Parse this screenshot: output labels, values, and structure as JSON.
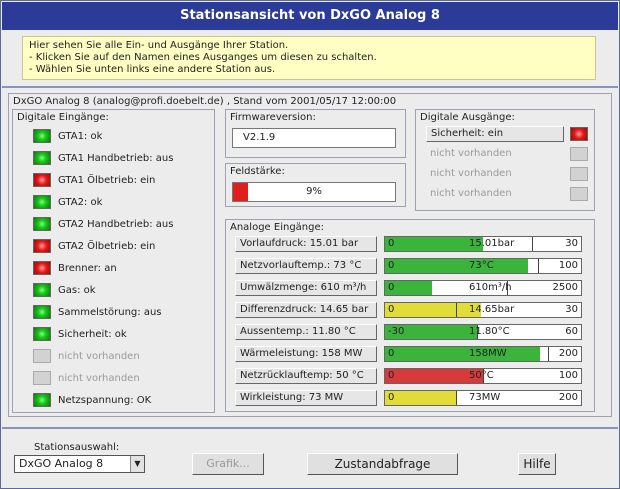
{
  "window": {
    "title": "Stationsansicht von DxGO Analog 8"
  },
  "info": {
    "lines": [
      "Hier sehen Sie alle Ein- und Ausgänge Ihrer Station.",
      "- Klicken Sie auf den Namen eines Ausganges um diesen zu schalten.",
      "- Wählen Sie unten links eine andere Station aus."
    ]
  },
  "station_line": "DxGO Analog 8 (analog@profi.doebelt.de) , Stand vom 2001/05/17 12:00:00",
  "digital_inputs": {
    "title": "Digitale Eingänge:",
    "items": [
      {
        "label": "GTA1: ok",
        "state": "green"
      },
      {
        "label": "GTA1 Handbetrieb: aus",
        "state": "green"
      },
      {
        "label": "GTA1 Ölbetrieb: ein",
        "state": "red"
      },
      {
        "label": "GTA2: ok",
        "state": "green"
      },
      {
        "label": "GTA2 Handbetrieb: aus",
        "state": "green"
      },
      {
        "label": "GTA2 Ölbetrieb: ein",
        "state": "red"
      },
      {
        "label": "Brenner: an",
        "state": "red"
      },
      {
        "label": "Gas: ok",
        "state": "green"
      },
      {
        "label": "Sammelstörung: aus",
        "state": "green"
      },
      {
        "label": "Sicherheit: ok",
        "state": "green"
      },
      {
        "label": "nicht vorhanden",
        "state": "gray"
      },
      {
        "label": "nicht vorhanden",
        "state": "gray"
      },
      {
        "label": "Netzspannung: OK",
        "state": "green"
      }
    ]
  },
  "firmware": {
    "title": "Firmwareversion:",
    "value": "V2.1.9"
  },
  "signal": {
    "title": "Feldstärke:",
    "value_text": "9%",
    "fraction": 0.09
  },
  "digital_outputs": {
    "title": "Digitale Ausgänge:",
    "items": [
      {
        "label": "Sicherheit: ein",
        "state": "red",
        "enabled": true
      },
      {
        "label": "nicht vorhanden",
        "state": "gray",
        "enabled": false
      },
      {
        "label": "nicht vorhanden",
        "state": "gray",
        "enabled": false
      },
      {
        "label": "nicht vorhanden",
        "state": "gray",
        "enabled": false
      }
    ]
  },
  "analog_inputs": {
    "title": "Analoge Eingänge:",
    "items": [
      {
        "label": "Vorlaufdruck: 15.01 bar",
        "min": "0",
        "max": "30",
        "value_text": "15.01bar",
        "fraction": 0.5,
        "color": "green",
        "mark": 0.75
      },
      {
        "label": "Netzvorlauftemp.: 73 °C",
        "min": "0",
        "max": "100",
        "value_text": "73°C",
        "fraction": 0.73,
        "color": "green",
        "mark": 0.78
      },
      {
        "label": "Umwälzmenge: 610 m³/h",
        "min": "0",
        "max": "2500",
        "value_text": "610m³/h",
        "fraction": 0.24,
        "color": "green",
        "mark": 0.62
      },
      {
        "label": "Differenzdruck: 14.65 bar",
        "min": "0",
        "max": "30",
        "value_text": "14.65bar",
        "fraction": 0.49,
        "color": "yellow",
        "mark": 0.36
      },
      {
        "label": "Aussentemp.: 11.80 °C",
        "min": "-30",
        "max": "60",
        "value_text": "11.80°C",
        "fraction": 0.47,
        "color": "green",
        "mark": 0.47
      },
      {
        "label": "Wärmeleistung: 158 MW",
        "min": "0",
        "max": "200",
        "value_text": "158MW",
        "fraction": 0.79,
        "color": "green",
        "mark": 0.83
      },
      {
        "label": "Netzrücklauftemp: 50 °C",
        "min": "0",
        "max": "100",
        "value_text": "50°C",
        "fraction": 0.5,
        "color": "red",
        "mark": 0.5
      },
      {
        "label": "Wirkleistung: 73 MW",
        "min": "0",
        "max": "200",
        "value_text": "73MW",
        "fraction": 0.36,
        "color": "yellow",
        "mark": 0.36
      }
    ]
  },
  "footer": {
    "station_select_label": "Stationsauswahl:",
    "station_selected": "DxGO Analog 8",
    "grafik_label": "Grafik...",
    "status_label": "Zustandabfrage",
    "help_label": "Hilfe"
  }
}
